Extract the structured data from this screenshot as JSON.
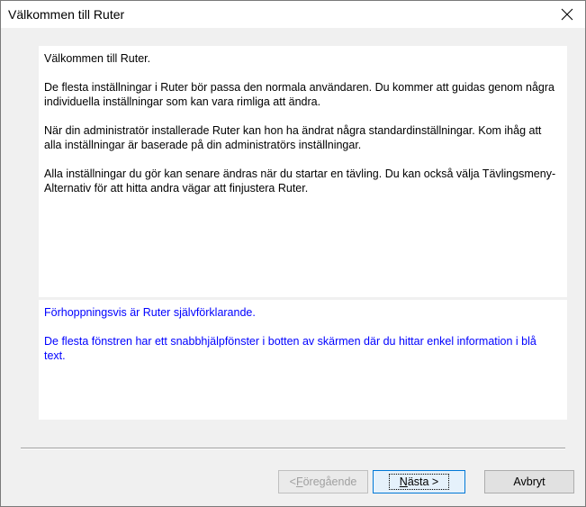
{
  "window": {
    "title": "Välkommen till Ruter",
    "close_glyph": "✕"
  },
  "main_panel": {
    "paragraphs": [
      "Välkommen till Ruter.",
      "De flesta inställningar i Ruter bör passa den normala användaren. Du kommer att guidas genom några individuella inställningar som kan vara rimliga att ändra.",
      "När din administratör installerade Ruter kan hon ha ändrat några standardinställningar. Kom ihåg att alla inställningar är baserade på din administratörs inställningar.",
      "Alla inställningar du gör kan senare ändras när du startar en tävling. Du kan också välja Tävlingsmeny-Alternativ för att hitta andra vägar att finjustera Ruter."
    ]
  },
  "help_panel": {
    "color": "#0000ff",
    "paragraphs": [
      "Förhoppningsvis är Ruter självförklarande.",
      "De flesta fönstren har ett snabbhjälpfönster i botten av skärmen där du hittar enkel information i blå text."
    ]
  },
  "buttons": {
    "prev_arrow": "< ",
    "prev_mnemonic": "F",
    "prev_rest": "öregående",
    "prev_enabled": false,
    "next_mnemonic": "N",
    "next_rest": "ästa >",
    "cancel": "Avbryt"
  }
}
